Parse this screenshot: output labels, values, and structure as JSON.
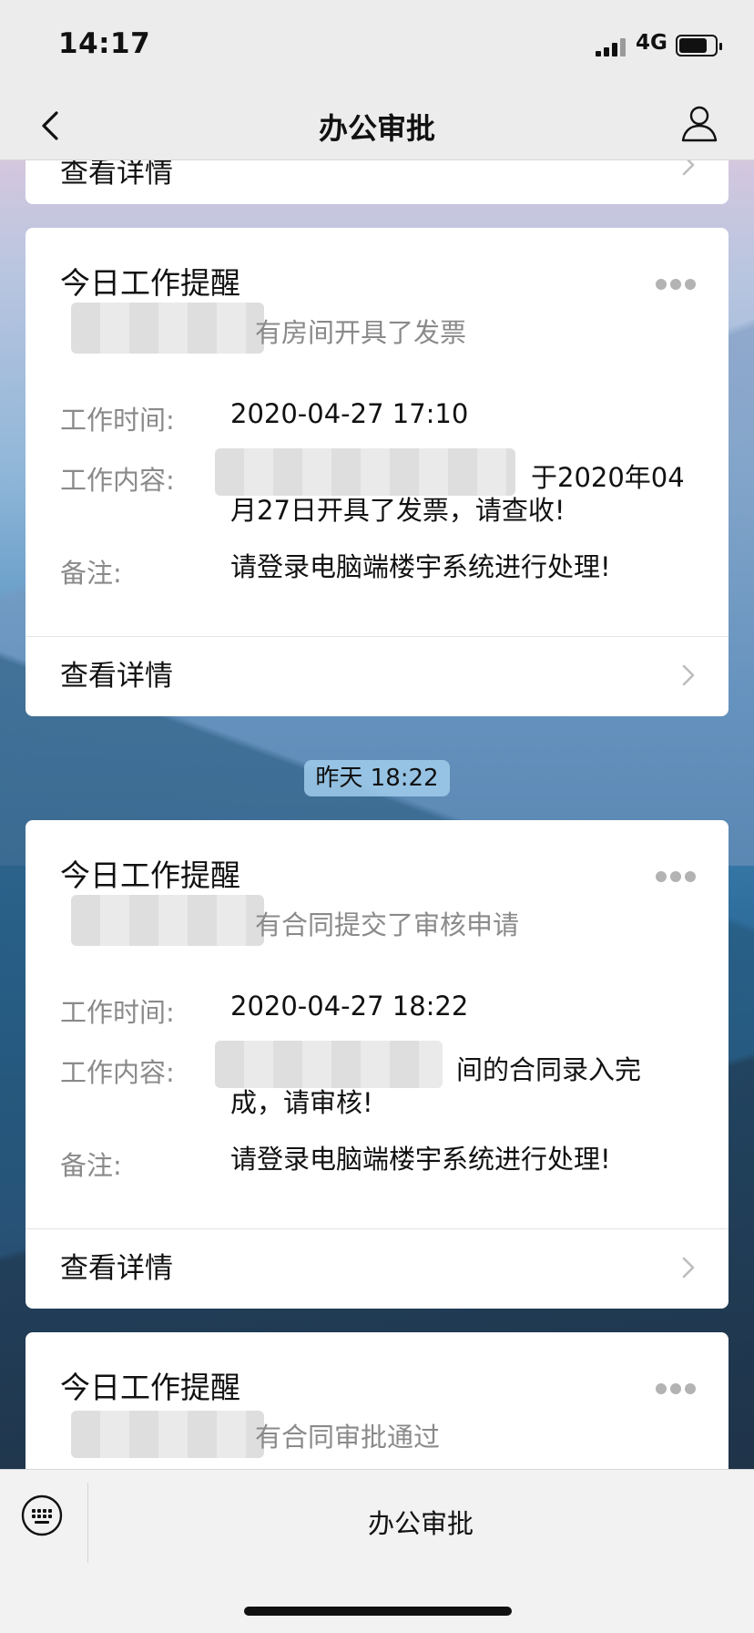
{
  "status_bar": {
    "time": "14:17",
    "network": "4G"
  },
  "nav": {
    "title": "办公审批"
  },
  "partial_card": {
    "detail_label": "查看详情"
  },
  "cards": [
    {
      "title": "今日工作提醒",
      "subtitle": "有房间开具了发票",
      "rows": [
        {
          "label": "工作时间:",
          "value": "2020-04-27 17:10"
        },
        {
          "label": "工作内容:",
          "value": "于2020年04月27日开具了发票，请查收!"
        },
        {
          "label": "备注:",
          "value": "请登录电脑端楼宇系统进行处理!"
        }
      ],
      "detail_label": "查看详情"
    },
    {
      "title": "今日工作提醒",
      "subtitle": "有合同提交了审核申请",
      "rows": [
        {
          "label": "工作时间:",
          "value": "2020-04-27 18:22"
        },
        {
          "label": "工作内容:",
          "value": "间的合同录入完成，请审核!"
        },
        {
          "label": "备注:",
          "value": "请登录电脑端楼宇系统进行处理!"
        }
      ],
      "detail_label": "查看详情"
    },
    {
      "title": "今日工作提醒",
      "subtitle": "有合同审批通过"
    }
  ],
  "time_separator": "昨天 18:22",
  "bottom_bar": {
    "menu_label": "办公审批"
  },
  "icons": {
    "back": "chevron-left-icon",
    "user": "person-icon",
    "more": "more-dots-icon",
    "chevron": "chevron-right-icon",
    "keyboard": "keyboard-icon"
  }
}
